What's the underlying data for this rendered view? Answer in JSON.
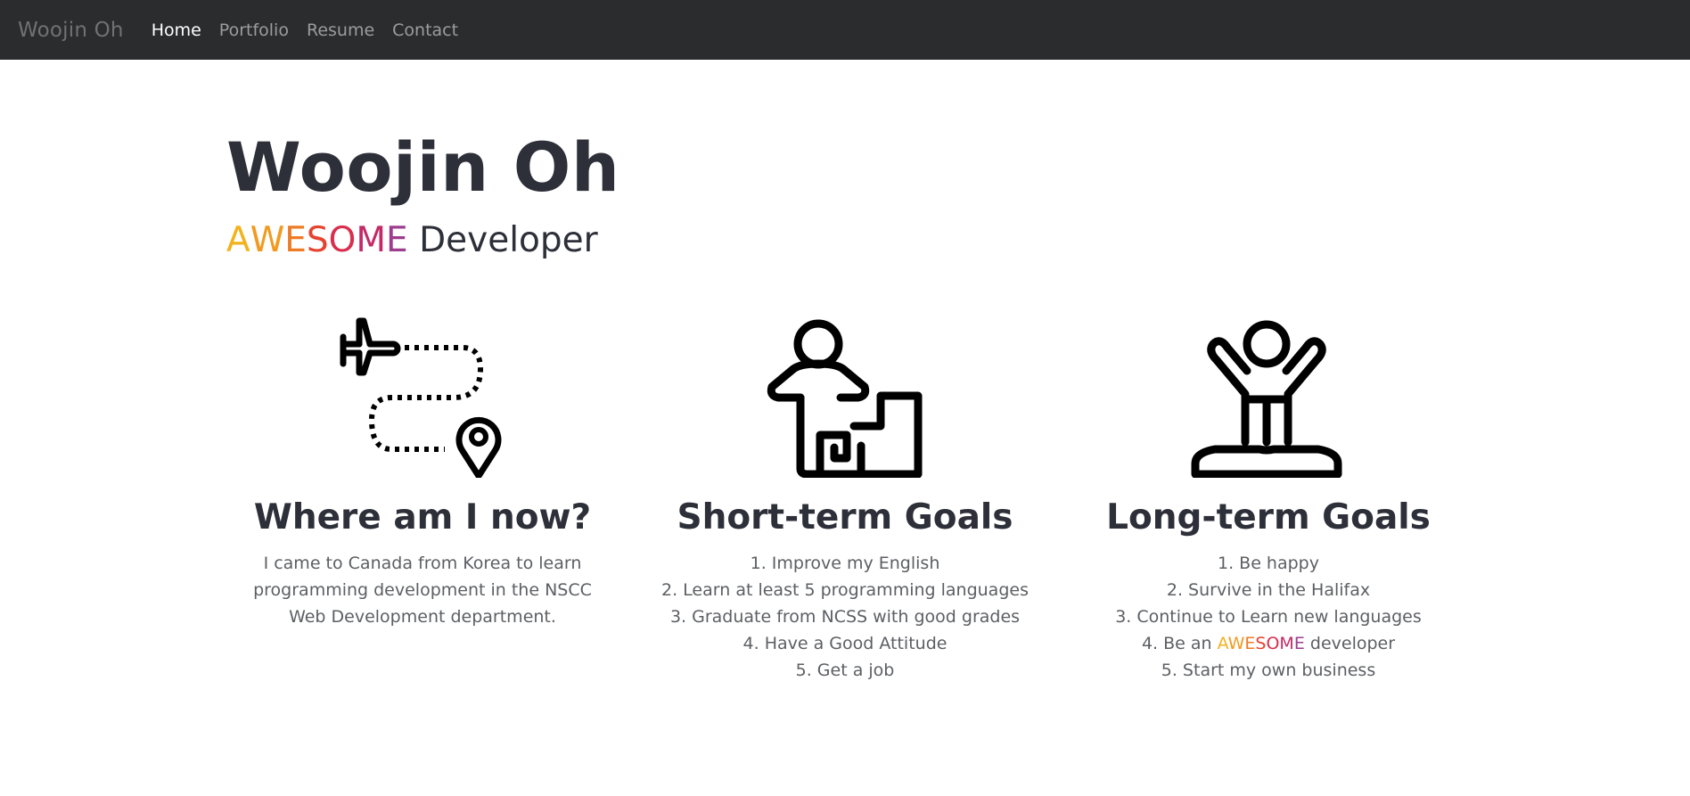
{
  "nav": {
    "brand": "Woojin Oh",
    "links": [
      "Home",
      "Portfolio",
      "Resume",
      "Contact"
    ],
    "active": "Home"
  },
  "hero": {
    "name": "Woojin Oh",
    "awesome_letters": [
      "A",
      "W",
      "E",
      "S",
      "O",
      "M",
      "E"
    ],
    "awesome_colors": [
      "#f2b21c",
      "#f29a1f",
      "#ee7b26",
      "#e6432f",
      "#d92e4d",
      "#c42968",
      "#9c3d8d"
    ],
    "role": "Developer"
  },
  "columns": [
    {
      "icon": "plane-route-icon",
      "title": "Where am I now?",
      "body": [
        "I came to Canada from Korea to learn",
        "programming development in the NSCC",
        "Web Development department."
      ]
    },
    {
      "icon": "person-maze-icon",
      "title": "Short-term Goals",
      "body": [
        "1. Improve my English",
        "2. Learn at least 5 programming languages",
        "3. Graduate from NCSS with good grades",
        "4. Have a Good Attitude",
        "5. Get a job"
      ]
    },
    {
      "icon": "person-arms-up-icon",
      "title": "Long-term Goals",
      "body": [
        "1. Be happy",
        "2. Survive in the Halifax",
        "3. Continue to Learn new languages",
        "4. Be an",
        "developer",
        "5. Start my own business"
      ]
    }
  ]
}
